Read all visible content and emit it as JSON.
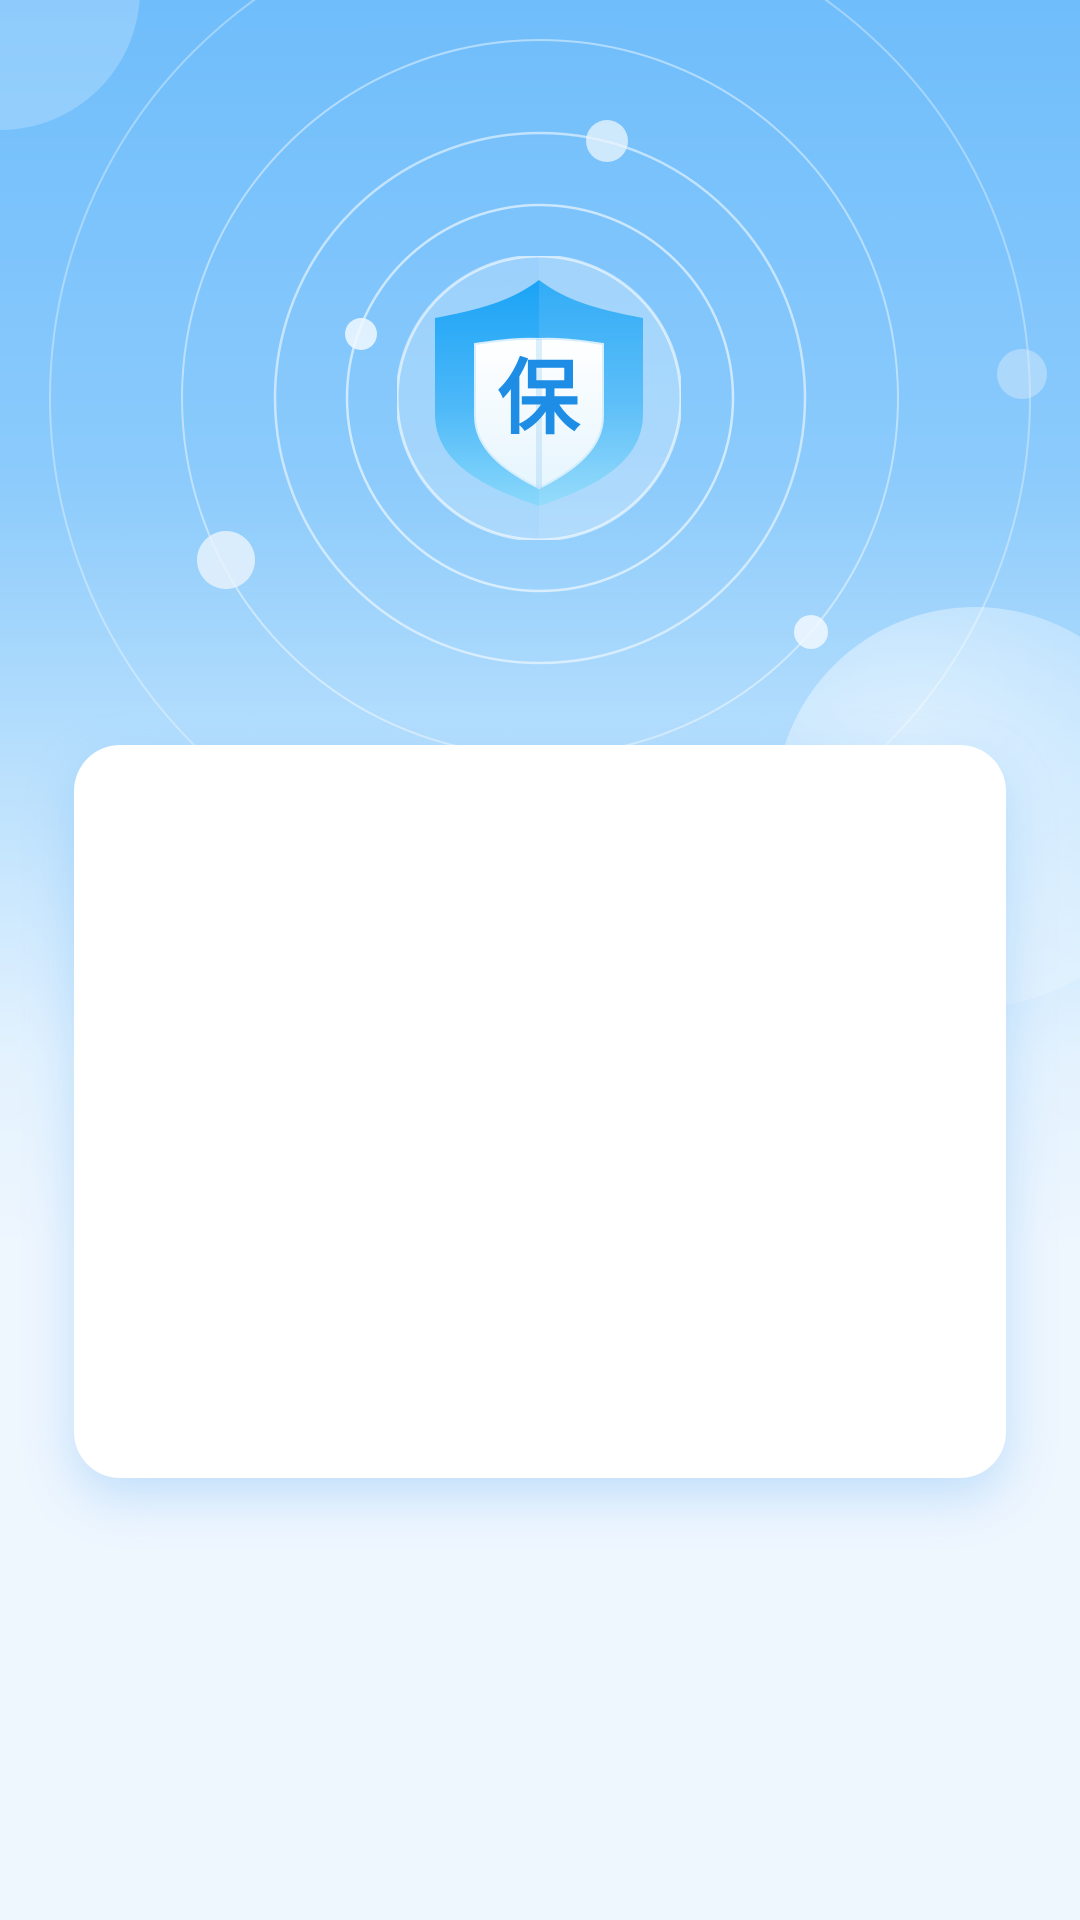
{
  "emblem": {
    "glyph": "保",
    "icon": "shield-icon"
  },
  "colors": {
    "background_top": "#6fbdfb",
    "background_bottom": "#eef6fe",
    "shield_top": "#1ba3f6",
    "shield_bottom": "#8ad8fb",
    "glyph_color": "#1e8de6",
    "card": "#ffffff"
  },
  "card": {}
}
